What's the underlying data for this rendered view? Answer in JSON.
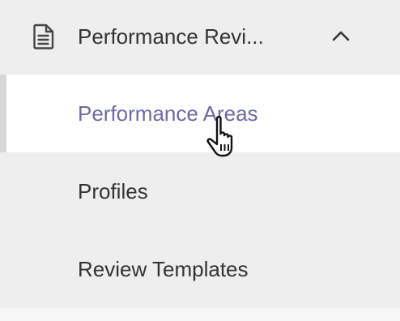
{
  "header": {
    "icon": "document-icon",
    "label": "Performance Revi...",
    "chevron": "chevron-up-icon"
  },
  "items": [
    {
      "label": "Performance Areas",
      "active": true
    },
    {
      "label": "Profiles",
      "active": false
    },
    {
      "label": "Review Templates",
      "active": false
    }
  ],
  "cursor": "hand-pointer-icon",
  "colors": {
    "active_text": "#6b6ba8",
    "text": "#333333",
    "menu_bg": "#eeeeee",
    "active_bg": "#ffffff",
    "active_indicator": "#d6d6d6"
  }
}
